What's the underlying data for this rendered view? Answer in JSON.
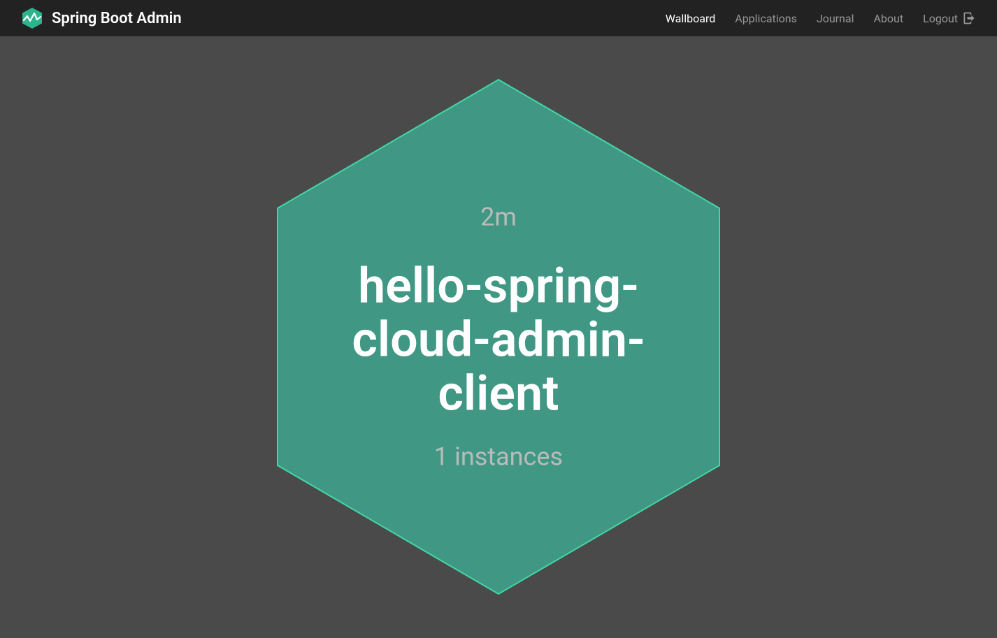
{
  "header": {
    "brand": "Spring Boot Admin",
    "nav": [
      {
        "label": "Wallboard",
        "active": true
      },
      {
        "label": "Applications",
        "active": false
      },
      {
        "label": "Journal",
        "active": false
      },
      {
        "label": "About",
        "active": false
      }
    ],
    "logout": "Logout"
  },
  "wallboard": {
    "app": {
      "uptime": "2m",
      "name": "hello-spring-cloud-admin-client",
      "instances": "1 instances",
      "status_color": "#3f9784",
      "border_color": "#42d7a6"
    }
  }
}
